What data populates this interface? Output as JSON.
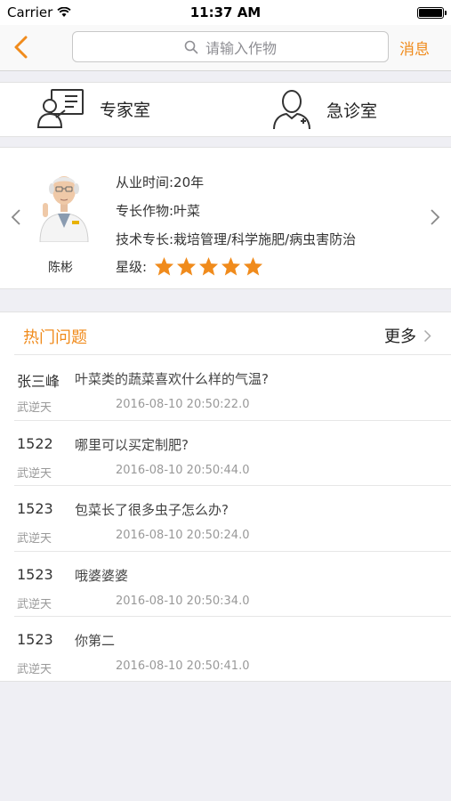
{
  "status_bar": {
    "carrier": "Carrier",
    "time": "11:37 AM"
  },
  "navbar": {
    "search_placeholder": "请输入作物",
    "message_label": "消息"
  },
  "rooms": {
    "expert_label": "专家室",
    "emergency_label": "急诊室"
  },
  "expert": {
    "name": "陈彬",
    "experience": "从业时间:20年",
    "specialty_crop": "专长作物:叶菜",
    "tech_specialty": "技术专长:栽培管理/科学施肥/病虫害防治",
    "rating_label": "星级:",
    "stars": 5
  },
  "hot_questions": {
    "title": "热门问题",
    "more_label": "更多",
    "items": [
      {
        "user": "张三峰",
        "question": "叶菜类的蔬菜喜欢什么样的气温?",
        "author": "武逆天",
        "time": "2016-08-10 20:50:22.0"
      },
      {
        "user": "1522",
        "question": "哪里可以买定制肥?",
        "author": "武逆天",
        "time": "2016-08-10 20:50:44.0"
      },
      {
        "user": "1523",
        "question": "包菜长了很多虫子怎么办?",
        "author": "武逆天",
        "time": "2016-08-10 20:50:24.0"
      },
      {
        "user": "1523",
        "question": "哦婆婆婆",
        "author": "武逆天",
        "time": "2016-08-10 20:50:34.0"
      },
      {
        "user": "1523",
        "question": "你第二",
        "author": "武逆天",
        "time": "2016-08-10 20:50:41.0"
      }
    ]
  },
  "colors": {
    "accent": "#f08b1c",
    "background": "#efeff4"
  }
}
